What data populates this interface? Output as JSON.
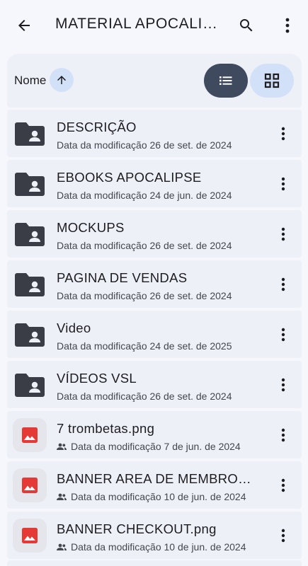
{
  "appbar": {
    "title": "MATERIAL  APOCALIPSE",
    "back_icon": "arrow-back-icon",
    "search_icon": "search-icon",
    "more_icon": "more-vert-icon"
  },
  "sortbar": {
    "sort_label": "Nome",
    "sort_direction": "ascending",
    "active_view": "list"
  },
  "colors": {
    "folder": "#3a3d45",
    "image_icon": "#e53935",
    "active_view_bg": "#3f4a5e",
    "inactive_view_bg": "#d3e1f8",
    "row_bg": "#eef0f8"
  },
  "items": [
    {
      "name": "DESCRIÇÃO",
      "meta": "Data da modificação 26 de set. de 2024",
      "type": "folder"
    },
    {
      "name": "EBOOKS APOCALIPSE",
      "meta": "Data da modificação 24 de jun. de 2024",
      "type": "folder"
    },
    {
      "name": "MOCKUPS",
      "meta": "Data da modificação 26 de set. de 2024",
      "type": "folder"
    },
    {
      "name": "PAGINA DE VENDAS",
      "meta": "Data da modificação 26 de set. de 2024",
      "type": "folder"
    },
    {
      "name": "Video",
      "meta": "Data da modificação 24 de set. de 2025",
      "type": "folder"
    },
    {
      "name": "VÍDEOS VSL",
      "meta": "Data da modificação 26 de set. de 2024",
      "type": "folder"
    },
    {
      "name": "7 trombetas.png",
      "meta": "Data da modificação 7 de jun. de 2024",
      "type": "image"
    },
    {
      "name": "BANNER AREA DE MEMBROS.png",
      "meta": "Data da modificação 10 de jun. de 2024",
      "type": "image"
    },
    {
      "name": "BANNER CHECKOUT.png",
      "meta": "Data da modificação 10 de jun. de 2024",
      "type": "image"
    }
  ]
}
